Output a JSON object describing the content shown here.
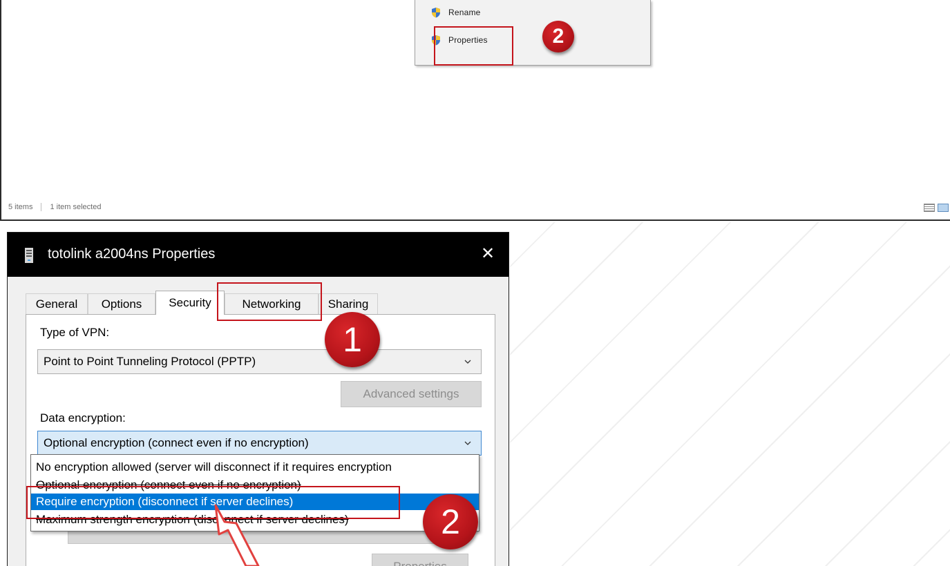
{
  "explorer": {
    "context_menu": {
      "items": [
        {
          "label": "Rename"
        },
        {
          "label": "Properties"
        }
      ]
    },
    "status": {
      "items_count": "5 items",
      "selected": "1 item selected"
    }
  },
  "dialog": {
    "title": "totolink a2004ns Properties",
    "close_label": "✕",
    "tabs": [
      {
        "label": "General"
      },
      {
        "label": "Options"
      },
      {
        "label": "Security"
      },
      {
        "label": "Networking"
      },
      {
        "label": "Sharing"
      }
    ],
    "active_tab": "Security",
    "vpn_type_label": "Type of VPN:",
    "vpn_type_value": "Point to Point Tunneling Protocol (PPTP)",
    "advanced_settings_label": "Advanced settings",
    "data_encryption_label": "Data encryption:",
    "data_encryption_value": "Optional encryption (connect even if no encryption)",
    "encryption_options": [
      {
        "label": "No encryption allowed (server will disconnect if it requires encryption"
      },
      {
        "label": "Optional encryption (connect even if no encryption)"
      },
      {
        "label": "Require encryption (disconnect if server declines)"
      },
      {
        "label": "Maximum strength encryption (disconnect if server declines)"
      }
    ],
    "properties_button_label": "Properties"
  },
  "annotations": {
    "badge_top": "2",
    "badge_networking": "1",
    "badge_require": "2",
    "color": "#c4141b"
  }
}
